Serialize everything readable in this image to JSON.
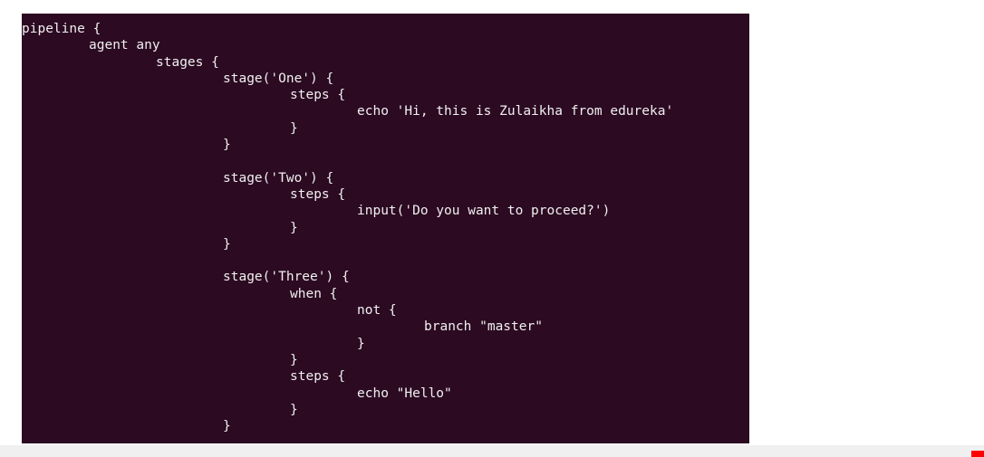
{
  "terminal": {
    "background_color": "#2c0a22",
    "text_color": "#f0f0f0",
    "lines": [
      {
        "indent": 0,
        "text": "pipeline {"
      },
      {
        "indent": 1,
        "text": "agent any"
      },
      {
        "indent": 2,
        "text": "stages {"
      },
      {
        "indent": 3,
        "text": "stage('One') {"
      },
      {
        "indent": 4,
        "text": "steps {"
      },
      {
        "indent": 5,
        "text": "echo 'Hi, this is Zulaikha from edureka'"
      },
      {
        "indent": 4,
        "text": "}"
      },
      {
        "indent": 3,
        "text": "}"
      },
      {
        "indent": 0,
        "text": ""
      },
      {
        "indent": 3,
        "text": "stage('Two') {"
      },
      {
        "indent": 4,
        "text": "steps {"
      },
      {
        "indent": 5,
        "text": "input('Do you want to proceed?')"
      },
      {
        "indent": 4,
        "text": "}"
      },
      {
        "indent": 3,
        "text": "}"
      },
      {
        "indent": 0,
        "text": ""
      },
      {
        "indent": 3,
        "text": "stage('Three') {"
      },
      {
        "indent": 4,
        "text": "when {"
      },
      {
        "indent": 5,
        "text": "not {"
      },
      {
        "indent": 6,
        "text": "branch \"master\""
      },
      {
        "indent": 5,
        "text": "}"
      },
      {
        "indent": 4,
        "text": "}"
      },
      {
        "indent": 4,
        "text": "steps {"
      },
      {
        "indent": 5,
        "text": "echo \"Hello\""
      },
      {
        "indent": 4,
        "text": "}"
      },
      {
        "indent": 3,
        "text": "}"
      }
    ]
  }
}
